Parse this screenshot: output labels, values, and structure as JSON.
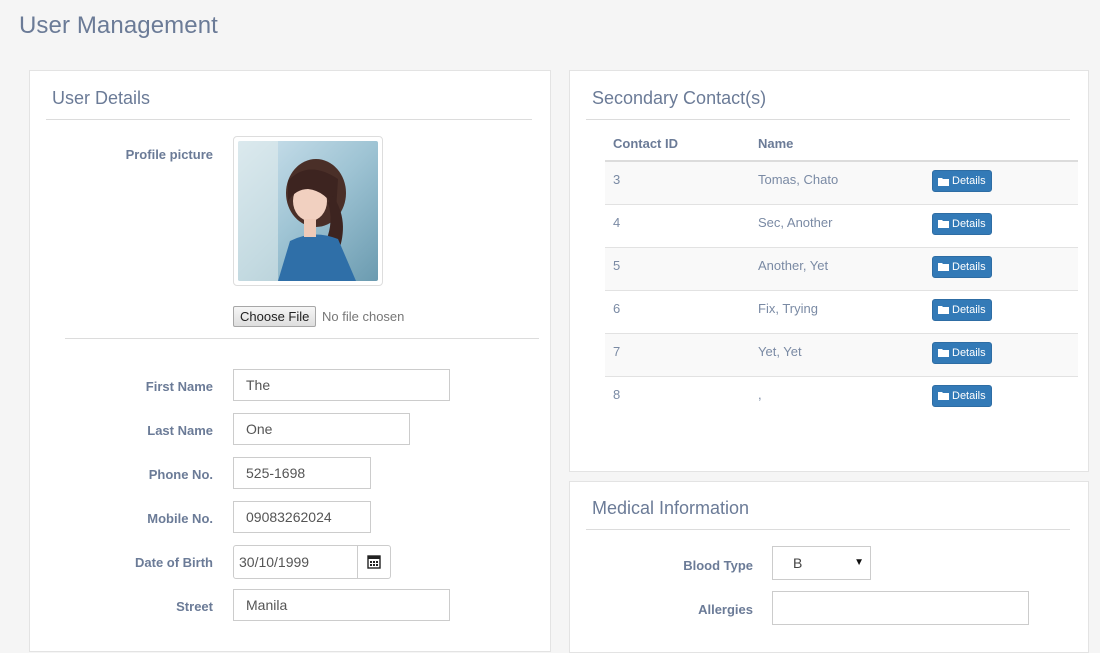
{
  "page": {
    "title": "User Management"
  },
  "user_details": {
    "title": "User Details",
    "profile_picture_label": "Profile picture",
    "file_button": "Choose File",
    "file_status": "No file chosen",
    "fields": {
      "first_name": {
        "label": "First Name",
        "value": "The"
      },
      "last_name": {
        "label": "Last Name",
        "value": "One"
      },
      "phone": {
        "label": "Phone No.",
        "value": "525-1698"
      },
      "mobile": {
        "label": "Mobile No.",
        "value": "09083262024"
      },
      "dob": {
        "label": "Date of Birth",
        "value": "30/10/1999"
      },
      "street": {
        "label": "Street",
        "value": "Manila"
      }
    }
  },
  "secondary_contacts": {
    "title": "Secondary Contact(s)",
    "columns": [
      "Contact ID",
      "Name"
    ],
    "details_label": "Details",
    "rows": [
      {
        "id": "3",
        "name": "Tomas, Chato"
      },
      {
        "id": "4",
        "name": "Sec, Another"
      },
      {
        "id": "5",
        "name": "Another, Yet"
      },
      {
        "id": "6",
        "name": "Fix, Trying"
      },
      {
        "id": "7",
        "name": "Yet, Yet"
      },
      {
        "id": "8",
        "name": ","
      }
    ]
  },
  "medical": {
    "title": "Medical Information",
    "blood_type_label": "Blood Type",
    "blood_type_value": "B",
    "allergies_label": "Allergies",
    "allergies_value": ""
  },
  "colors": {
    "accent": "#337ab7",
    "text": "#6b7b97"
  },
  "icons": {
    "date": "calendar-icon",
    "details": "folder-icon",
    "select": "caret-down-icon"
  }
}
